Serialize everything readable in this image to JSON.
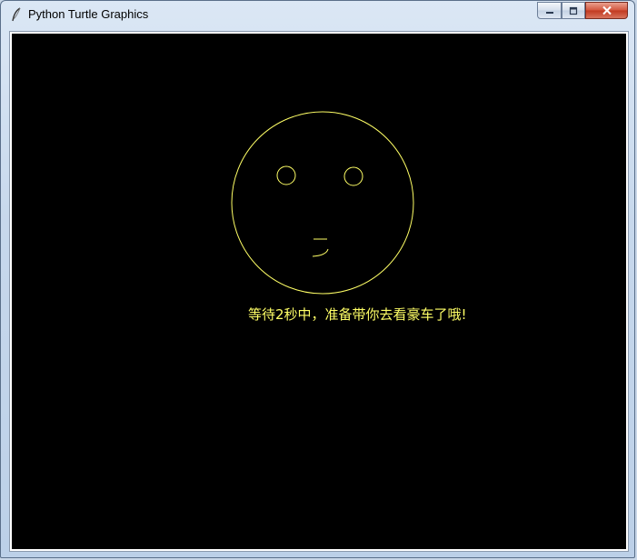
{
  "window": {
    "title": "Python Turtle Graphics"
  },
  "controls": {
    "minimize_icon": "minimize-icon",
    "maximize_icon": "maximize-icon",
    "close_icon": "close-icon"
  },
  "canvas": {
    "background": "#000000",
    "pen_color": "#ffff66",
    "message": "等待2秒中，准备带你去看豪车了哦!"
  }
}
